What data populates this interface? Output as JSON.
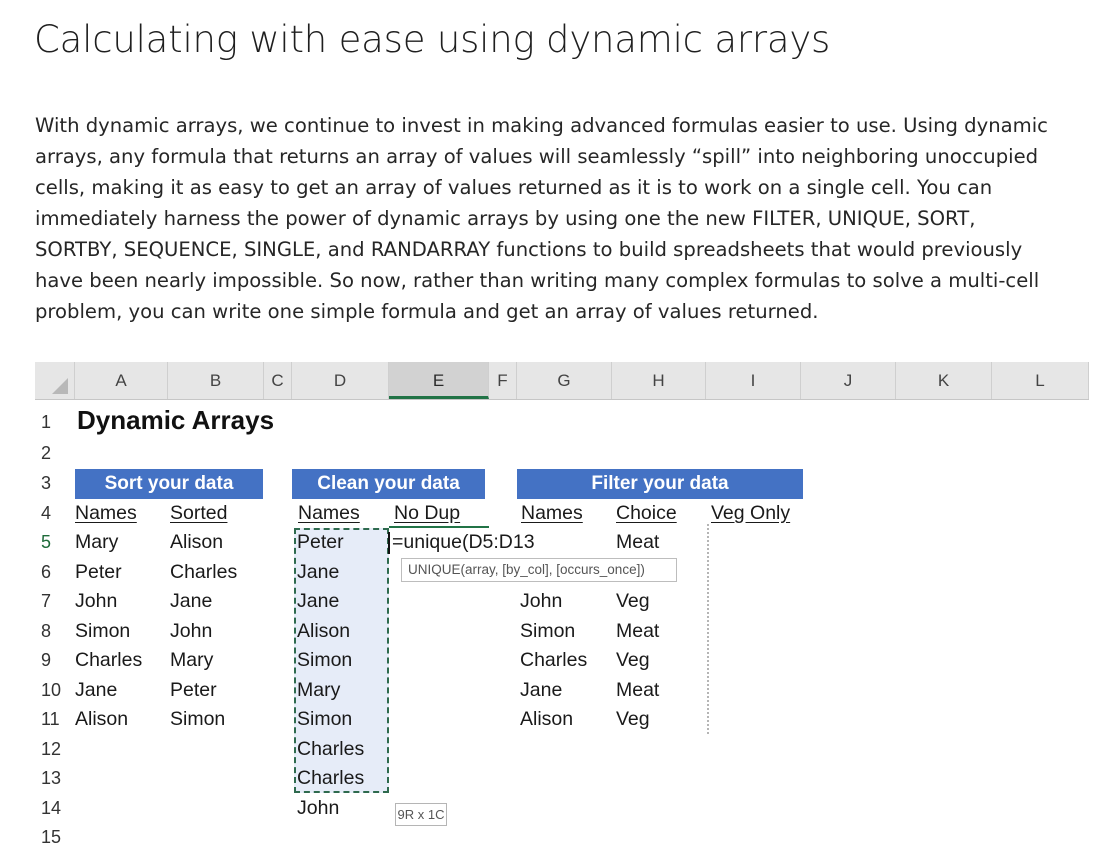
{
  "article": {
    "title": "Calculating with ease using dynamic arrays",
    "paragraph_lines": [
      "With dynamic arrays, we continue to invest in making advanced formulas easier to use. Using dynamic",
      "arrays, any formula that returns an array of values will seamlessly “spill” into neighboring unoccupied",
      "cells, making it as easy to get an array of values returned as it is to work on a single cell. You can",
      "immediately harness the power of dynamic arrays by using one the new FILTER, UNIQUE, SORT,",
      "SORTBY, SEQUENCE, SINGLE, and RANDARRAY functions to build spreadsheets that would previously",
      "have been nearly impossible. So now, rather than writing many complex formulas to solve a multi-cell",
      "problem, you can write one simple formula and get an array of values returned."
    ]
  },
  "sheet": {
    "columns": [
      "A",
      "B",
      "C",
      "D",
      "E",
      "F",
      "G",
      "H",
      "I",
      "J",
      "K",
      "L"
    ],
    "selected_column": "E",
    "rows": [
      "1",
      "2",
      "3",
      "4",
      "5",
      "6",
      "7",
      "8",
      "9",
      "10",
      "11",
      "12",
      "13",
      "14",
      "15"
    ],
    "selected_row": "5",
    "sheet_title": "Dynamic Arrays",
    "sort_section": {
      "band": "Sort your data",
      "col1_header": "Names",
      "col2_header": "Sorted",
      "names": [
        "Mary",
        "Peter",
        "John",
        "Simon",
        "Charles",
        "Jane",
        "Alison"
      ],
      "sorted": [
        "Alison",
        "Charles",
        "Jane",
        "John",
        "Mary",
        "Peter",
        "Simon"
      ]
    },
    "clean_section": {
      "band": "Clean your data",
      "col1_header": "Names",
      "col2_header": "No Dup",
      "names": [
        "Peter",
        "Jane",
        "Jane",
        "Alison",
        "Simon",
        "Mary",
        "Simon",
        "Charles",
        "Charles",
        "John"
      ],
      "formula": "=unique(D5:D13",
      "tooltip": "UNIQUE(array, [by_col], [occurs_once])",
      "spill_size": "9R x 1C"
    },
    "filter_section": {
      "band": "Filter your data",
      "col1_header": "Names",
      "col2_header": "Choice",
      "col3_header": "Veg Only",
      "names": [
        "",
        "",
        "John",
        "Simon",
        "Charles",
        "Jane",
        "Alison"
      ],
      "choices": [
        "Meat",
        "",
        "Veg",
        "Meat",
        "Veg",
        "Meat",
        "Veg"
      ]
    },
    "colors": {
      "band": "#4472c4",
      "spill_fill": "#e6ecf8",
      "selection_green": "#217346"
    }
  }
}
